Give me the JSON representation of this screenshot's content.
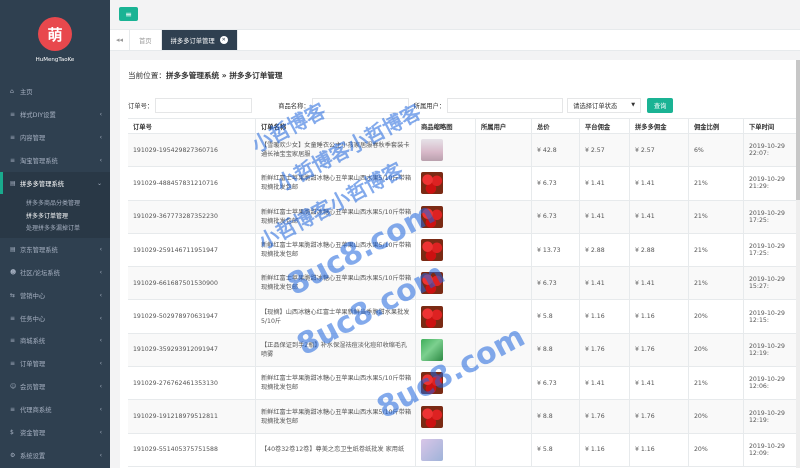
{
  "brand": {
    "logo_char": "萌",
    "name": "HuMengTaoKe"
  },
  "sidebar": {
    "items": [
      {
        "icon": "home-icon",
        "glyph": "⌂",
        "label": "主页",
        "chev": ""
      },
      {
        "icon": "list-icon",
        "glyph": "≡",
        "label": "样式DIY设置",
        "chev": "‹"
      },
      {
        "icon": "list-icon",
        "glyph": "≡",
        "label": "内容管理",
        "chev": "‹"
      },
      {
        "icon": "list-icon",
        "glyph": "≡",
        "label": "淘宝管理系统",
        "chev": "‹"
      },
      {
        "icon": "chart-icon",
        "glyph": "▤",
        "label": "拼多多管理系统",
        "chev": "⌄",
        "open": true
      },
      {
        "icon": "chart-icon",
        "glyph": "▤",
        "label": "京东管理系统",
        "chev": "‹"
      },
      {
        "icon": "users-icon",
        "glyph": "☻",
        "label": "社区/论坛系统",
        "chev": "‹"
      },
      {
        "icon": "share-icon",
        "glyph": "⇆",
        "label": "营销中心",
        "chev": "‹"
      },
      {
        "icon": "list-icon",
        "glyph": "≡",
        "label": "任务中心",
        "chev": "‹"
      },
      {
        "icon": "list-icon",
        "glyph": "≡",
        "label": "商城系统",
        "chev": "‹"
      },
      {
        "icon": "list-icon",
        "glyph": "≡",
        "label": "订单管理",
        "chev": "‹"
      },
      {
        "icon": "user-icon",
        "glyph": "☺",
        "label": "会员管理",
        "chev": "‹"
      },
      {
        "icon": "list-icon",
        "glyph": "≡",
        "label": "代理商系统",
        "chev": "‹"
      },
      {
        "icon": "money-icon",
        "glyph": "$",
        "label": "资金管理",
        "chev": "‹"
      },
      {
        "icon": "gear-icon",
        "glyph": "⚙",
        "label": "系统设置",
        "chev": "‹"
      }
    ],
    "subitems": [
      {
        "label": "拼多多商品分类管理"
      },
      {
        "label": "拼多多订单管理",
        "active": true
      },
      {
        "label": "处理拼多多漏掉订单"
      }
    ]
  },
  "tabs": {
    "back": "◂◂",
    "home": "首页",
    "active": "拼多多订单管理",
    "close": "✕"
  },
  "breadcrumb": {
    "prefix": "当前位置：",
    "path": "拼多多管理系统 » 拼多多订单管理"
  },
  "filters": {
    "order_no_label": "订单号：",
    "goods_name_label": "商品名称：",
    "user_label": "所属用户：",
    "status_select": "请选择订单状态",
    "query_label": "查询"
  },
  "table": {
    "headers": [
      "订单号",
      "订单名称",
      "商品缩略图",
      "所属用户",
      "总价",
      "平台佣金",
      "拼多多佣金",
      "佣金比例",
      "下单时间"
    ],
    "rows": [
      {
        "no": "191029-195429827360716",
        "name": "【雪暖欢少女】女童睡衣公主小孩家居服春秋季套装卡通长袖宝宝家居服",
        "img": "person",
        "user": "",
        "total": "¥ 42.8",
        "platform": "¥ 2.57",
        "pdd": "¥ 2.57",
        "ratio": "6%",
        "time": "2019-10-29 22:07:"
      },
      {
        "no": "191029-488457831210716",
        "name": "新鲜红富士苹果脆甜冰糖心丑苹果山西水果5/10斤带箱现摘批发包邮",
        "img": "apple",
        "user": "",
        "total": "¥ 6.73",
        "platform": "¥ 1.41",
        "pdd": "¥ 1.41",
        "ratio": "21%",
        "time": "2019-10-29 21:29:"
      },
      {
        "no": "191029-367773287352230",
        "name": "新鲜红富士苹果脆甜冰糖心丑苹果山西水果5/10斤带箱现摘批发包邮",
        "img": "apple",
        "user": "",
        "total": "¥ 6.73",
        "platform": "¥ 1.41",
        "pdd": "¥ 1.41",
        "ratio": "21%",
        "time": "2019-10-29 17:25:"
      },
      {
        "no": "191029-259146711951947",
        "name": "新鲜红富士苹果脆甜冰糖心丑苹果山西水果5/10斤带箱现摘批发包邮",
        "img": "apple",
        "user": "",
        "total": "¥ 13.73",
        "platform": "¥ 2.88",
        "pdd": "¥ 2.88",
        "ratio": "21%",
        "time": "2019-10-29 17:25:"
      },
      {
        "no": "191029-661687501530900",
        "name": "新鲜红富士苹果脆甜冰糖心丑苹果山西水果5/10斤带箱现摘批发包邮",
        "img": "apple",
        "user": "",
        "total": "¥ 6.73",
        "platform": "¥ 1.41",
        "pdd": "¥ 1.41",
        "ratio": "21%",
        "time": "2019-10-29 15:27:"
      },
      {
        "no": "191029-502978970631947",
        "name": "【现摘】山西冰糖心红富士苹果新鲜当季脆甜水果批发5/10斤",
        "img": "apple",
        "user": "",
        "total": "¥ 5.8",
        "platform": "¥ 1.16",
        "pdd": "¥ 1.16",
        "ratio": "20%",
        "time": "2019-10-29 12:15:"
      },
      {
        "no": "191029-359293912091947",
        "name": "【正品保证到手2瓶】补水保湿祛痘淡化痘印收缩毛孔喷雾",
        "img": "green",
        "user": "",
        "total": "¥ 8.8",
        "platform": "¥ 1.76",
        "pdd": "¥ 1.76",
        "ratio": "20%",
        "time": "2019-10-29 12:19:"
      },
      {
        "no": "191029-276762461353130",
        "name": "新鲜红富士苹果脆甜冰糖心丑苹果山西水果5/10斤带箱现摘批发包邮",
        "img": "apple",
        "user": "",
        "total": "¥ 6.73",
        "platform": "¥ 1.41",
        "pdd": "¥ 1.41",
        "ratio": "21%",
        "time": "2019-10-29 12:06:"
      },
      {
        "no": "191029-191218979512811",
        "name": "新鲜红富士苹果脆甜冰糖心丑苹果山西水果5/10斤带箱现摘批发包邮",
        "img": "apple",
        "user": "",
        "total": "¥ 8.8",
        "platform": "¥ 1.76",
        "pdd": "¥ 1.76",
        "ratio": "20%",
        "time": "2019-10-29 12:19:"
      },
      {
        "no": "191029-551405375751588",
        "name": "【40卷32卷12卷】尊美之恋卫生纸卷纸批发 家用纸",
        "img": "box",
        "user": "",
        "total": "¥ 5.8",
        "platform": "¥ 1.16",
        "pdd": "¥ 1.16",
        "ratio": "20%",
        "time": "2019-10-29 12:09:"
      }
    ]
  },
  "watermark": {
    "texts": [
      "小哲博客",
      "小哲博客小哲博客",
      "小哲博客小哲博客",
      "8uc8.com",
      "8uc8.com",
      "8uc8.com"
    ],
    "color": "#1e64dc"
  }
}
